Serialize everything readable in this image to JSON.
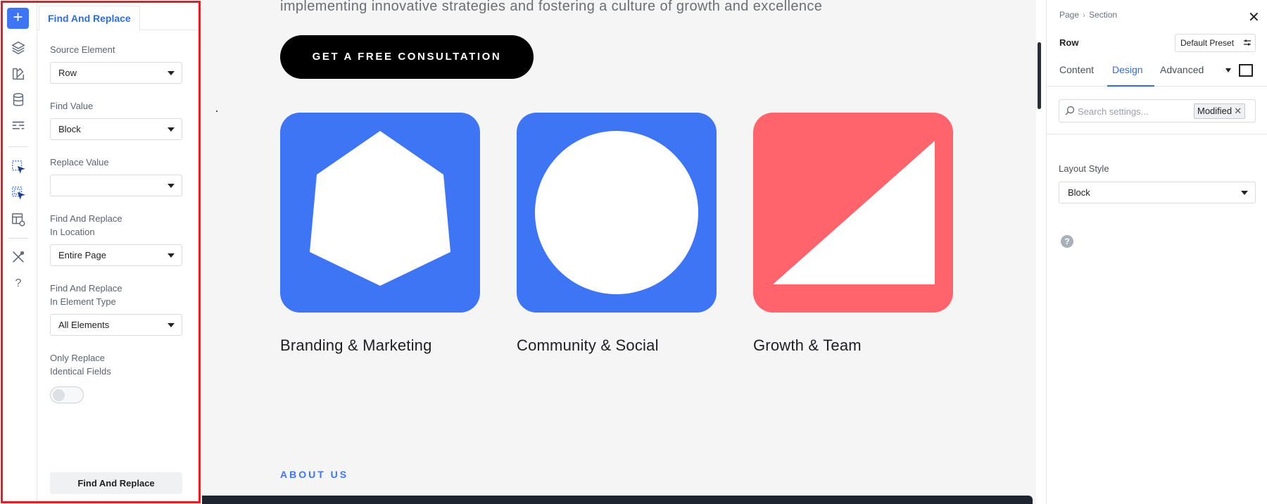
{
  "left_rail": {
    "add_icon_glyph": "+",
    "icons": [
      "layers-icon",
      "palette-icon",
      "database-icon",
      "form-icon",
      "select-cursor-icon",
      "select-multiple-icon",
      "template-settings-icon",
      "tools-icon",
      "help-icon"
    ],
    "help_glyph": "?"
  },
  "find_replace": {
    "tab_label": "Find And Replace",
    "source_element": {
      "label": "Source Element",
      "value": "Row"
    },
    "find_value": {
      "label": "Find Value",
      "value": "Block"
    },
    "replace_value": {
      "label": "Replace Value",
      "value": ""
    },
    "location": {
      "label_line1": "Find And Replace",
      "label_line2": "In Location",
      "value": "Entire Page"
    },
    "element_type": {
      "label_line1": "Find And Replace",
      "label_line2": "In Element Type",
      "value": "All Elements"
    },
    "identical": {
      "label_line1": "Only Replace",
      "label_line2": "Identical Fields",
      "enabled": false
    },
    "action_label": "Find And Replace",
    "highlight_color": "#e01e24"
  },
  "canvas": {
    "tagline": "implementing innovative strategies and fostering a culture of growth and excellence",
    "cta_label": "GET A FREE CONSULTATION",
    "cards": [
      {
        "title": "Branding & Marketing",
        "color": "#3e75f5",
        "shape": "hexagon"
      },
      {
        "title": "Community & Social",
        "color": "#3e75f5",
        "shape": "circle"
      },
      {
        "title": "Growth & Team",
        "color": "#ff636c",
        "shape": "triangle"
      }
    ],
    "about_label": "ABOUT US"
  },
  "settings": {
    "breadcrumb": [
      "Page",
      "Section"
    ],
    "close_glyph": "✕",
    "element_title": "Row",
    "preset_label": "Default Preset",
    "tabs": [
      "Content",
      "Design",
      "Advanced"
    ],
    "active_tab": "Design",
    "search_placeholder": "Search settings...",
    "filter_chip": "Modified",
    "layout_style": {
      "label": "Layout Style",
      "value": "Block"
    },
    "help_glyph": "?",
    "accent_color": "#2f6dd6"
  }
}
